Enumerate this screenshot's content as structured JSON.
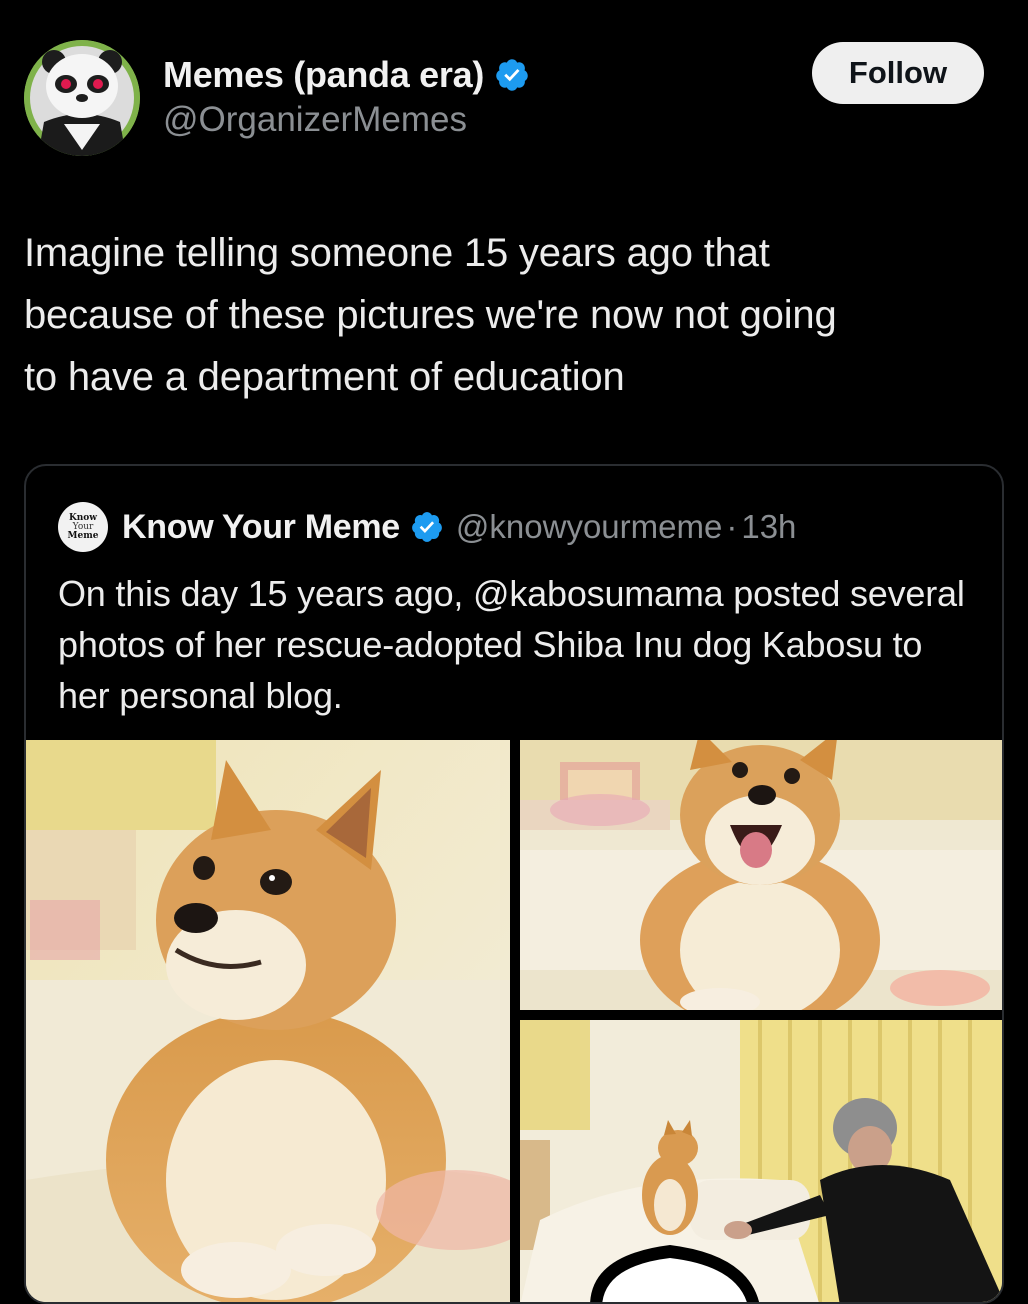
{
  "tweet": {
    "author": {
      "display_name": "Memes (panda era)",
      "handle": "@OrganizerMemes",
      "verified": true,
      "avatar_icon": "panda-avatar-icon"
    },
    "follow_label": "Follow",
    "text": "Imagine telling someone 15 years ago that\nbecause of these pictures  we're now not going\nto have a department of education"
  },
  "quote": {
    "logo_lines": [
      "Know",
      "Your",
      "Meme"
    ],
    "author_name": "Know Your Meme",
    "verified": true,
    "handle": "@knowyourmeme",
    "separator": "·",
    "time": "13h",
    "text": "On this day 15 years ago, @kabosumama posted several photos of her rescue-adopted Shiba Inu dog Kabosu to her personal blog.",
    "photos": [
      {
        "icon": "shiba-inu-side-eye-photo"
      },
      {
        "icon": "shiba-inu-barking-photo"
      },
      {
        "icon": "shiba-inu-with-owner-photo"
      }
    ]
  },
  "colors": {
    "background": "#000000",
    "verified_blue": "#1d9bf0",
    "muted_text": "#8b8f93",
    "follow_button_bg": "#efefef"
  }
}
